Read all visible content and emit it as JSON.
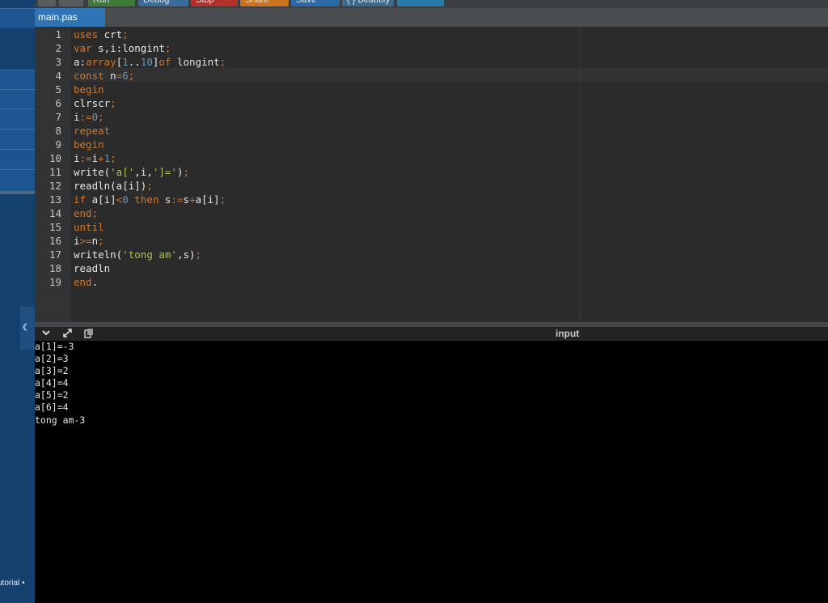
{
  "toolbar": {
    "buttons": [
      "Run",
      "Debug",
      "Stop",
      "Share",
      "Save",
      "{ } Beautify"
    ]
  },
  "file_tab": {
    "name": "main.pas"
  },
  "editor": {
    "line_numbers": [
      "1",
      "2",
      "3",
      "4",
      "5",
      "6",
      "7",
      "8",
      "9",
      "10",
      "11",
      "12",
      "13",
      "14",
      "15",
      "16",
      "17",
      "18",
      "19"
    ],
    "lines": [
      "uses crt;",
      "var s,i:longint;",
      "a:array[1..10]of longint;",
      "const n=6;",
      "begin",
      "clrscr;",
      "i:=0;",
      "repeat",
      "begin",
      "i:=i+1;",
      "write('a[',i,']=');",
      "readln(a[i]);",
      "if a[i]<0 then s:=s+a[i];",
      "end;",
      "until",
      "i>=n;",
      "writeln('tong am',s);",
      "readln",
      "end."
    ]
  },
  "io_panel": {
    "label": "input"
  },
  "console": {
    "lines": [
      "a[1]=-3",
      "a[2]=3",
      "a[3]=2",
      "a[4]=4",
      "a[5]=2",
      "a[6]=4",
      "tong am-3"
    ]
  },
  "sidebar": {
    "footer_text": "utorial •"
  },
  "colors": {
    "accent": "#2f74b5",
    "sidebar": "#14406e",
    "editor_bg": "#2b2b2b",
    "keyword": "#cc7832",
    "number": "#6897bb",
    "string": "#a5c25c"
  },
  "icons": [
    "chevron-down-icon",
    "expand-icon",
    "copy-icon",
    "collapse-left-icon"
  ]
}
